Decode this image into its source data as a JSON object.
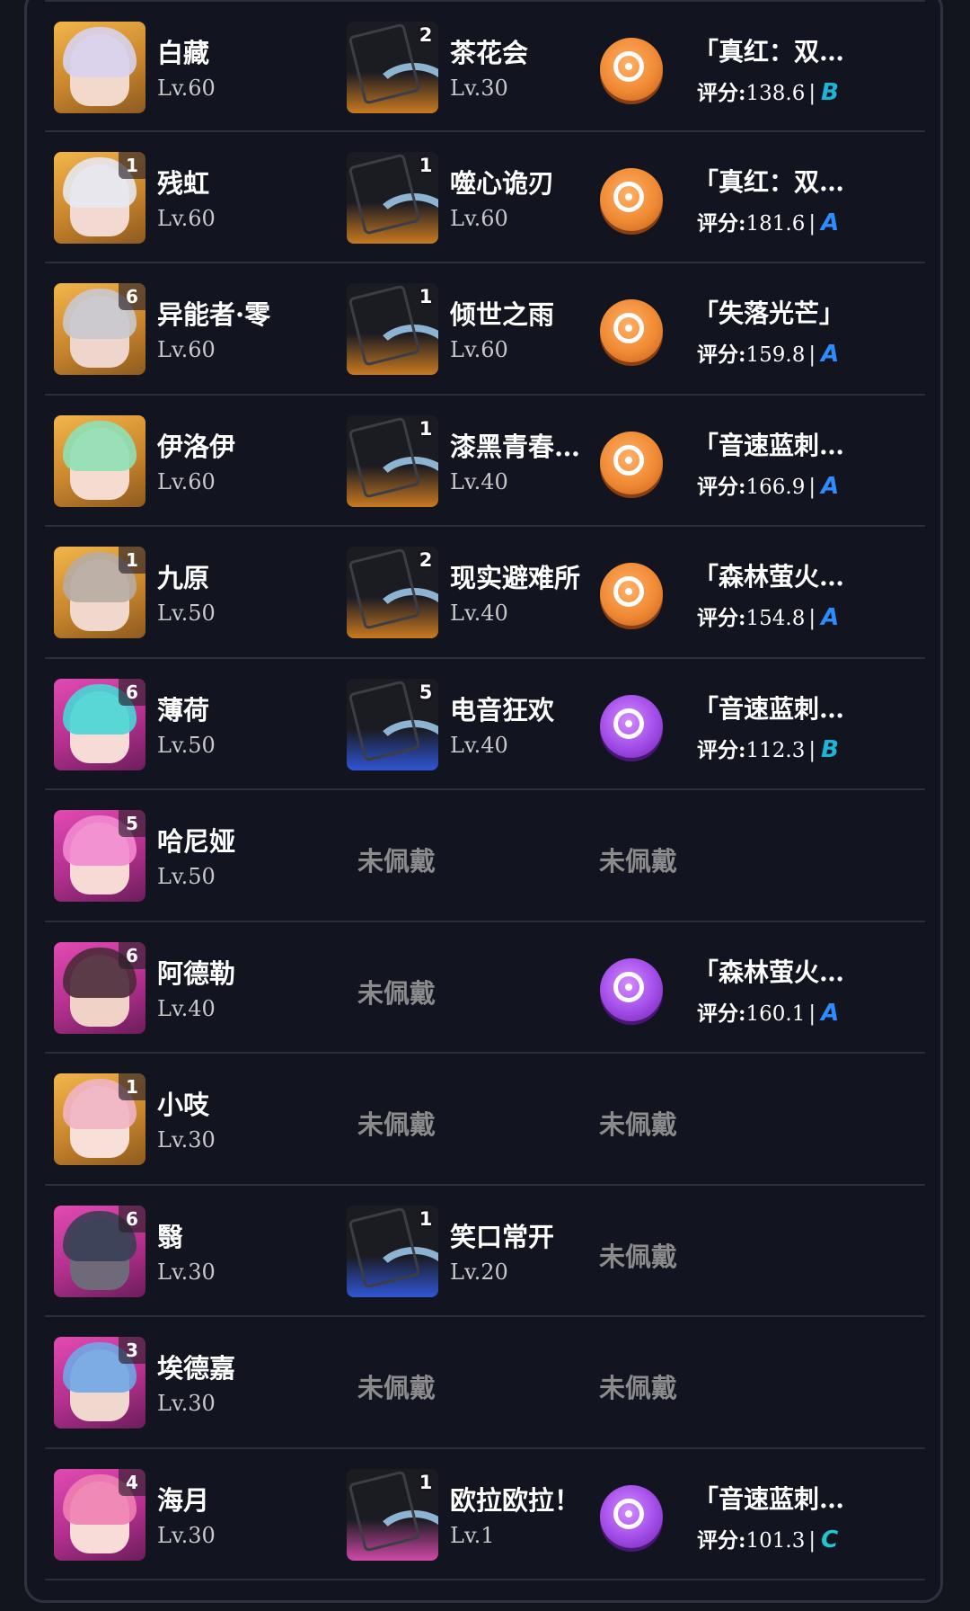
{
  "score_label": "评分:",
  "unequipped_label": "未佩戴",
  "rows": [
    {
      "name": "白藏",
      "level": "Lv.60",
      "char_rank": "",
      "char_bg": "gold",
      "hair": "#d7d3ee",
      "face": "#f3d8cc",
      "card": {
        "name": "茶花会",
        "level": "Lv.30",
        "rank": "2",
        "bg": "gold"
      },
      "disc": {
        "name": "「真红：双…",
        "score": "138.6",
        "grade": "B",
        "color": "orange"
      }
    },
    {
      "name": "残虹",
      "level": "Lv.60",
      "char_rank": "1",
      "char_bg": "gold",
      "hair": "#e6e8ef",
      "face": "#f2dad2",
      "card": {
        "name": "噬心诡刃",
        "level": "Lv.60",
        "rank": "1",
        "bg": "gold"
      },
      "disc": {
        "name": "「真红：双…",
        "score": "181.6",
        "grade": "A",
        "color": "orange"
      }
    },
    {
      "name": "异能者·零",
      "level": "Lv.60",
      "char_rank": "6",
      "char_bg": "gold",
      "hair": "#c9c9cf",
      "face": "#efd6cc",
      "card": {
        "name": "倾世之雨",
        "level": "Lv.60",
        "rank": "1",
        "bg": "gold"
      },
      "disc": {
        "name": "「失落光芒」",
        "score": "159.8",
        "grade": "A",
        "color": "orange"
      }
    },
    {
      "name": "伊洛伊",
      "level": "Lv.60",
      "char_rank": "",
      "char_bg": "gold",
      "hair": "#8fe0b6",
      "face": "#f6dcd0",
      "card": {
        "name": "漆黑青春…",
        "level": "Lv.40",
        "rank": "1",
        "bg": "gold"
      },
      "disc": {
        "name": "「音速蓝刺…",
        "score": "166.9",
        "grade": "A",
        "color": "orange"
      }
    },
    {
      "name": "九原",
      "level": "Lv.50",
      "char_rank": "1",
      "char_bg": "gold",
      "hair": "#b7aca3",
      "face": "#f0d9cc",
      "card": {
        "name": "现实避难所",
        "level": "Lv.40",
        "rank": "2",
        "bg": "gold"
      },
      "disc": {
        "name": "「森林萤火…",
        "score": "154.8",
        "grade": "A",
        "color": "orange"
      }
    },
    {
      "name": "薄荷",
      "level": "Lv.50",
      "char_rank": "6",
      "char_bg": "purple",
      "hair": "#48d6d6",
      "face": "#f6dbd6",
      "card": {
        "name": "电音狂欢",
        "level": "Lv.40",
        "rank": "5",
        "bg": "blue"
      },
      "disc": {
        "name": "「音速蓝刺…",
        "score": "112.3",
        "grade": "B",
        "color": "violet"
      }
    },
    {
      "name": "哈尼娅",
      "level": "Lv.50",
      "char_rank": "5",
      "char_bg": "purple",
      "hair": "#f28ad0",
      "face": "#f7dad6",
      "card": null,
      "disc": null
    },
    {
      "name": "阿德勒",
      "level": "Lv.40",
      "char_rank": "6",
      "char_bg": "purple",
      "hair": "#4b2a3a",
      "face": "#f1d2c6",
      "card": null,
      "disc": {
        "name": "「森林萤火…",
        "score": "160.1",
        "grade": "A",
        "color": "violet"
      }
    },
    {
      "name": "小吱",
      "level": "Lv.30",
      "char_rank": "1",
      "char_bg": "gold",
      "hair": "#f0b4c4",
      "face": "#f8e0d8",
      "card": null,
      "disc": null
    },
    {
      "name": "翳",
      "level": "Lv.30",
      "char_rank": "6",
      "char_bg": "purple",
      "hair": "#3a3f55",
      "face": "#6f6a7a",
      "card": {
        "name": "笑口常开",
        "level": "Lv.20",
        "rank": "1",
        "bg": "blue"
      },
      "disc": null
    },
    {
      "name": "埃德嘉",
      "level": "Lv.30",
      "char_rank": "3",
      "char_bg": "purple",
      "hair": "#6fa7e6",
      "face": "#f0d8ce",
      "card": null,
      "disc": null
    },
    {
      "name": "海月",
      "level": "Lv.30",
      "char_rank": "4",
      "char_bg": "purple",
      "hair": "#f07fb4",
      "face": "#f7dcd8",
      "card": {
        "name": "欧拉欧拉！",
        "level": "Lv.1",
        "rank": "1",
        "bg": "pink"
      },
      "disc": {
        "name": "「音速蓝刺…",
        "score": "101.3",
        "grade": "C",
        "color": "violet"
      }
    }
  ]
}
